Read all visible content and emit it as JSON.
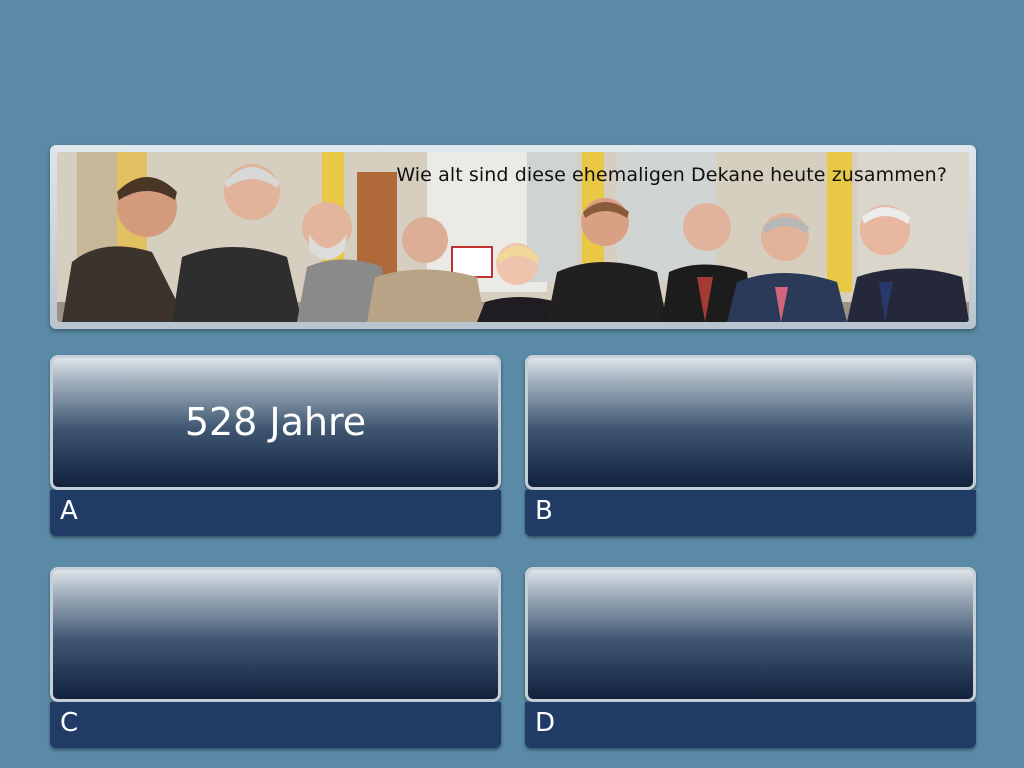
{
  "question": {
    "text": "Wie alt sind diese ehemaligen Dekane heute zusammen?",
    "photo_sign_text": "...närräume\n...7, 118"
  },
  "answers": [
    {
      "letter": "A",
      "text": "528 Jahre"
    },
    {
      "letter": "B",
      "text": ""
    },
    {
      "letter": "C",
      "text": ""
    },
    {
      "letter": "D",
      "text": ""
    }
  ],
  "colors": {
    "background": "#5a8aa5",
    "letter_bar": "#1f3b66",
    "button_dark": "#0f1f3a"
  }
}
